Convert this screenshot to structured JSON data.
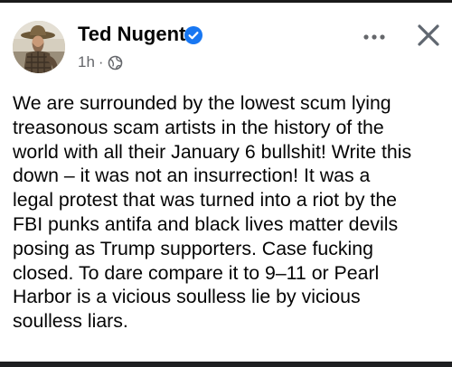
{
  "post": {
    "author": {
      "name": "Ted Nugent",
      "verified": true,
      "avatar": "user-profile-photo"
    },
    "timestamp": "1h",
    "separator": "·",
    "audience_icon": "globe-icon",
    "actions": {
      "more_icon": "more-horizontal-icon",
      "close_icon": "close-icon"
    },
    "text": "We are surrounded by the lowest scum lying\ntreasonous scam artists in the history of the\nworld with all their January 6 bullshit! Write this\ndown – it was not an insurrection! It was a\nlegal protest that was turned into a riot by the\nFBI punks antifa and black lives matter devils\nposing as Trump supporters. Case fucking\nclosed. To dare compare it to 9–11 or Pearl\nHarbor is a vicious soulless lie by vicious\nsoulless liars."
  },
  "colors": {
    "verified_badge": "#1877f2",
    "secondary_text": "#65676b",
    "primary_text": "#050505"
  }
}
